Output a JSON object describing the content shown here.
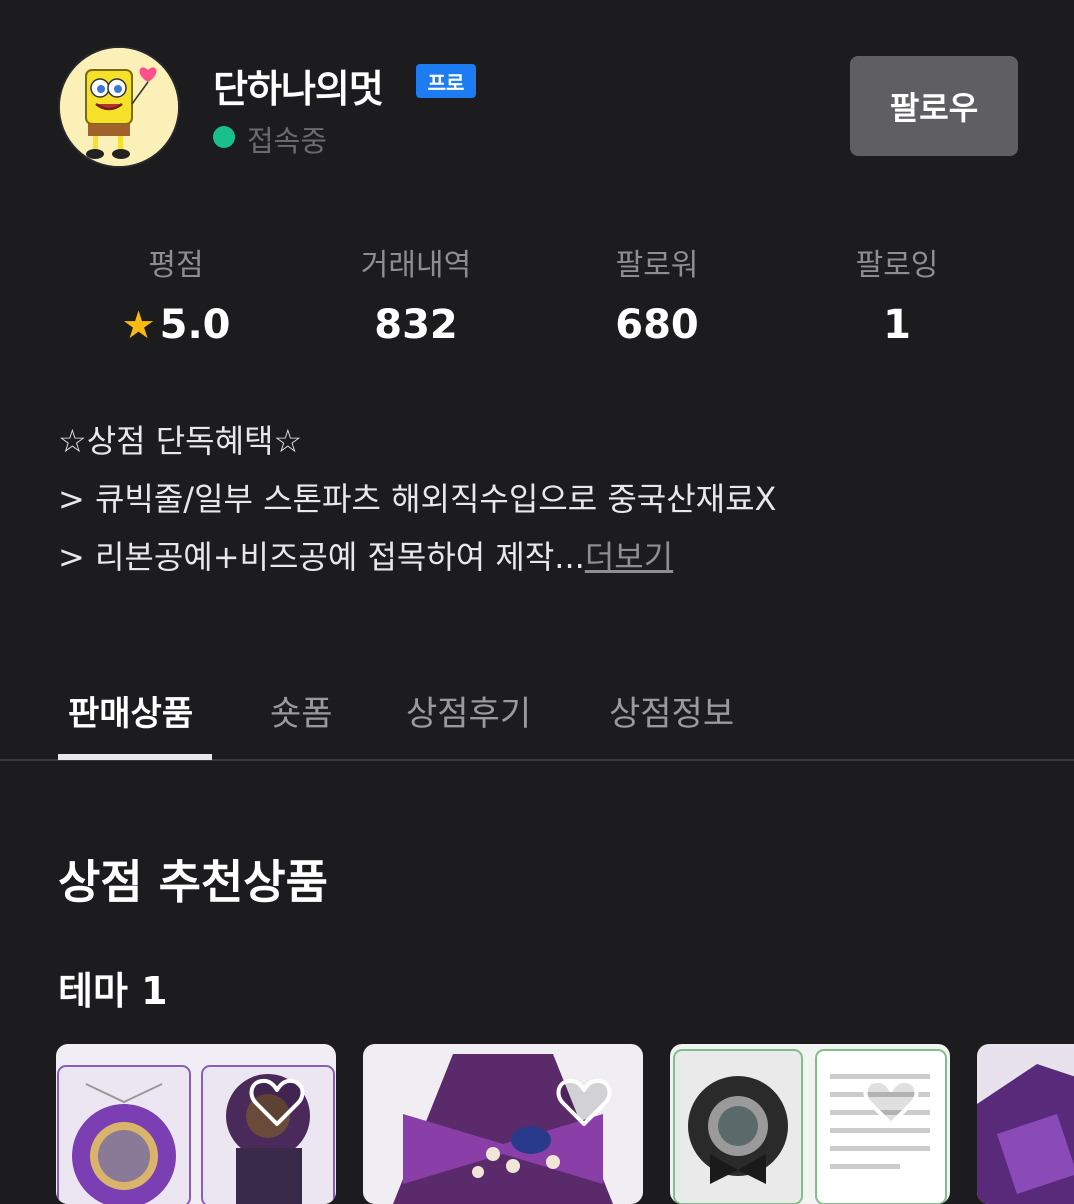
{
  "profile": {
    "name": "단하나의멋",
    "badge": "프로",
    "status": "접속중",
    "follow_label": "팔로우",
    "avatar_icon": "spongebob-avatar"
  },
  "stats": [
    {
      "label": "평점",
      "value": "5.0",
      "icon": "star-icon"
    },
    {
      "label": "거래내역",
      "value": "832"
    },
    {
      "label": "팔로워",
      "value": "680"
    },
    {
      "label": "팔로잉",
      "value": "1"
    }
  ],
  "bio": {
    "lines": [
      "☆상점 단독혜택☆",
      "> 큐빅줄/일부 스톤파츠 해외직수입으로 중국산재료X",
      "> 리본공예+비즈공예 접목하여 제작..."
    ],
    "more": "더보기"
  },
  "tabs": [
    "판매상품",
    "숏폼",
    "상점후기",
    "상점정보"
  ],
  "active_tab": "판매상품",
  "section": {
    "title": "상점 추천상품",
    "theme": "테마 1"
  },
  "colors": {
    "background": "#1c1c1f",
    "pro_badge": "#1d7cf2",
    "online": "#19c08a",
    "star": "#f8b912",
    "follow_button": "#5f5f62"
  }
}
